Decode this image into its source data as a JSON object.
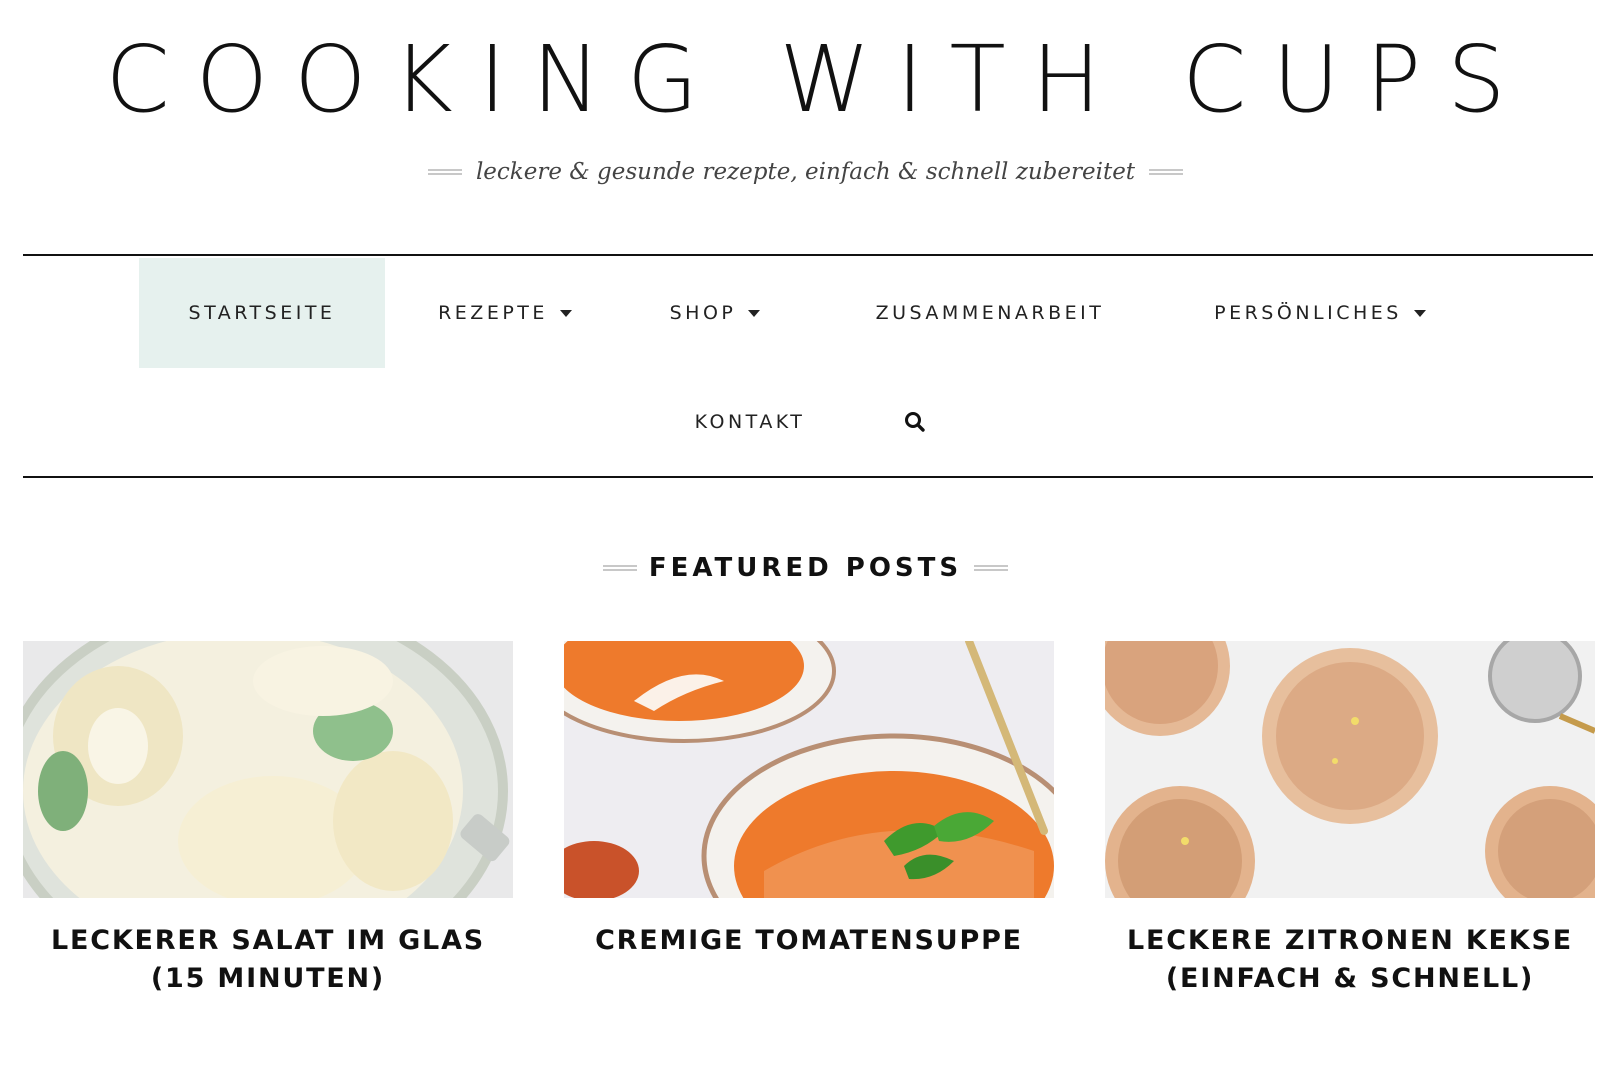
{
  "header": {
    "site_title": "COOKING WITH CUPS",
    "tagline": "leckere & gesunde rezepte, einfach & schnell zubereitet"
  },
  "nav": {
    "items": [
      {
        "label": "STARTSEITE",
        "active": true,
        "has_dropdown": false
      },
      {
        "label": "REZEPTE",
        "active": false,
        "has_dropdown": true
      },
      {
        "label": "SHOP",
        "active": false,
        "has_dropdown": true
      },
      {
        "label": "ZUSAMMENARBEIT",
        "active": false,
        "has_dropdown": false
      },
      {
        "label": "PERSÖNLICHES",
        "active": false,
        "has_dropdown": true
      },
      {
        "label": "KONTAKT",
        "active": false,
        "has_dropdown": false
      }
    ],
    "search_icon": "search-icon",
    "active_bg": "#e6f1ee"
  },
  "featured": {
    "heading": "FEATURED POSTS",
    "posts": [
      {
        "title_line1": "LECKERER SALAT IM GLAS",
        "title_line2": "(15 MINUTEN)"
      },
      {
        "title_line1": "CREMIGE TOMATENSUPPE",
        "title_line2": ""
      },
      {
        "title_line1": "LECKERE ZITRONEN KEKSE",
        "title_line2": "(EINFACH & SCHNELL)"
      }
    ]
  }
}
